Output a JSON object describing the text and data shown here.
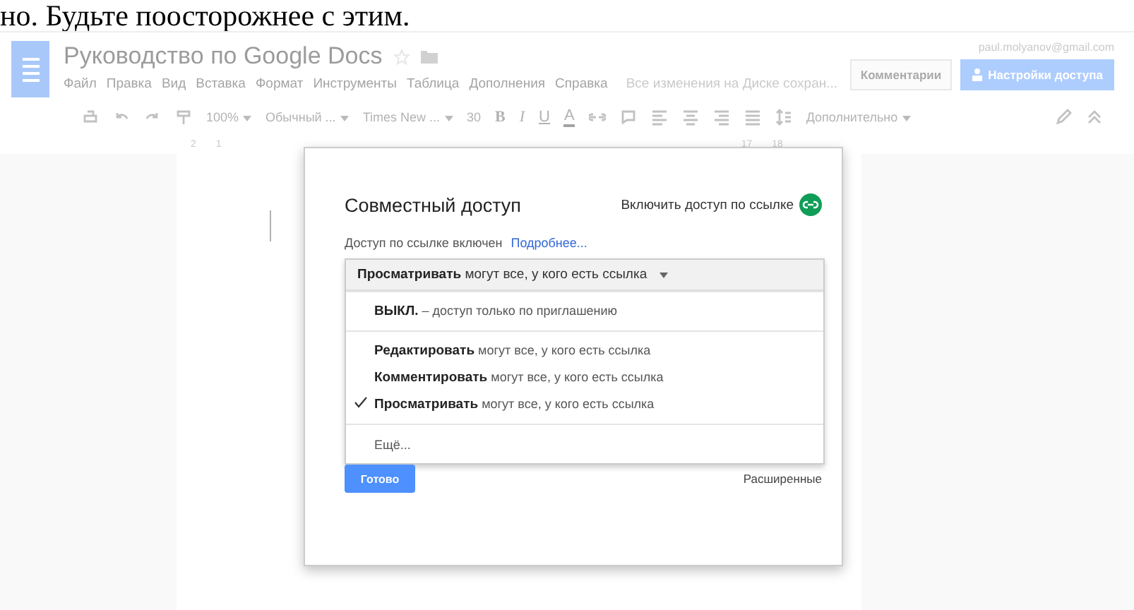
{
  "caption": "но. Будьте поосторожнее с этим.",
  "docs": {
    "title": "Руководство по Google Docs",
    "account": "paul.molyanov@gmail.com",
    "menu": [
      "Файл",
      "Правка",
      "Вид",
      "Вставка",
      "Формат",
      "Инструменты",
      "Таблица",
      "Дополнения",
      "Справка"
    ],
    "save_status": "Все изменения на Диске сохран...",
    "comments_button": "Комментарии",
    "share_button": "Настройки доступа",
    "toolbar": {
      "zoom": "100%",
      "style": "Обычный ...",
      "font": "Times New ...",
      "size": "30",
      "bold": "B",
      "italic": "I",
      "underline": "U",
      "text_color": "A",
      "more": "Дополнительно"
    },
    "ruler": [
      "2",
      "1",
      "17",
      "18"
    ]
  },
  "dialog": {
    "title": "Совместный доступ",
    "link_toggle": "Включить доступ по ссылке",
    "link_status": "Доступ по ссылке включен",
    "learn_more": "Подробнее...",
    "dropdown": {
      "value": "**Просматривать** могут все, у кого есть ссылка",
      "groups": [
        [
          {
            "label": "**ВЫКЛ.** – доступ только по приглашению",
            "selected": false
          }
        ],
        [
          {
            "label": "**Редактировать** могут все, у кого есть ссылка",
            "selected": false
          },
          {
            "label": "**Комментировать** могут все, у кого есть ссылка",
            "selected": false
          },
          {
            "label": "**Просматривать** могут все, у кого есть ссылка",
            "selected": true
          }
        ],
        [
          {
            "label": "Ещё...",
            "selected": false
          }
        ]
      ]
    },
    "done_button": "Готово",
    "advanced": "Расширенные"
  }
}
